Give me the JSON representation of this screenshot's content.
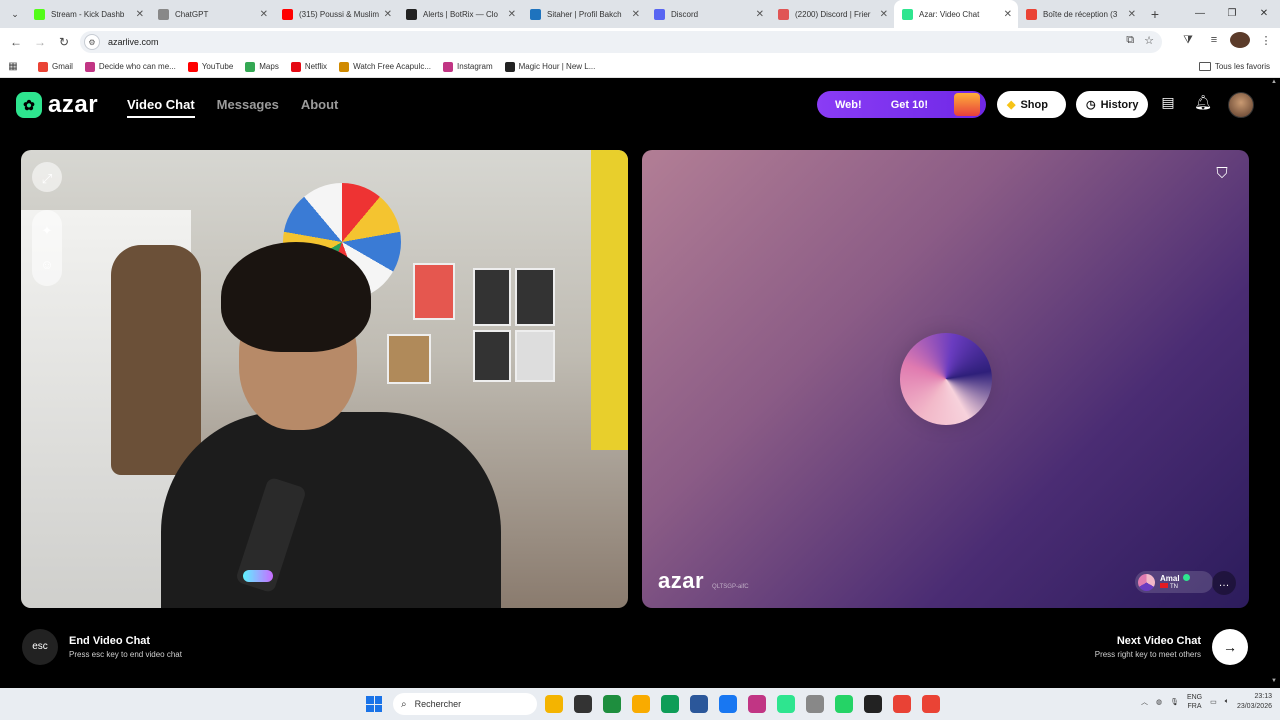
{
  "browser": {
    "tabs": [
      {
        "title": "Stream - Kick Dashb",
        "color": "#53fc18"
      },
      {
        "title": "ChatGPT",
        "color": "#888888"
      },
      {
        "title": "(315) Poussi & Muslim",
        "color": "#ff0000"
      },
      {
        "title": "Alerts | BotRix — Clo",
        "color": "#222222"
      },
      {
        "title": "Sitaher | Profil Bakch",
        "color": "#1e73be"
      },
      {
        "title": "Discord",
        "color": "#5865f2"
      },
      {
        "title": "(2200) Discord | Frier",
        "color": "#e05555"
      },
      {
        "title": "Azar: Video Chat",
        "color": "#2ee58f",
        "active": true
      },
      {
        "title": "Boîte de réception (3",
        "color": "#ea4335"
      }
    ],
    "url": "azarlive.com",
    "bookmarks": [
      {
        "label": "Gmail",
        "color": "#ea4335"
      },
      {
        "label": "Decide who can me...",
        "color": "#c13584"
      },
      {
        "label": "YouTube",
        "color": "#ff0000"
      },
      {
        "label": "Maps",
        "color": "#34a853"
      },
      {
        "label": "Netflix",
        "color": "#e50914"
      },
      {
        "label": "Watch Free Acapulc...",
        "color": "#d08a00"
      },
      {
        "label": "Instagram",
        "color": "#c13584"
      },
      {
        "label": "Magic Hour | New L...",
        "color": "#222222"
      }
    ],
    "all_bookmarks_label": "Tous les favoris"
  },
  "app": {
    "logo_text": "azar",
    "nav": [
      {
        "label": "Video Chat",
        "active": true
      },
      {
        "label": "Messages",
        "active": false
      },
      {
        "label": "About",
        "active": false
      }
    ],
    "promo": {
      "web_label": "Web!",
      "get_label": "Get 10!"
    },
    "shop_label": "Shop",
    "history_label": "History",
    "watermark_logo": "azar",
    "watermark_code": "QLTSGP-aifC",
    "partner": {
      "name": "Amal",
      "country": "TN"
    },
    "end_key": "esc",
    "end_title": "End Video Chat",
    "end_sub": "Press esc key to end video chat",
    "next_title": "Next Video Chat",
    "next_sub": "Press right key to meet others",
    "accent": "#2ee58f"
  },
  "taskbar": {
    "search_placeholder": "Rechercher",
    "lang_top": "ENG",
    "lang_bottom": "FRA",
    "time": "23:13",
    "date": "23/03/2026",
    "apps": [
      "#f4b400",
      "#333333",
      "#1e8e3e",
      "#f9ab00",
      "#0f9d58",
      "#2b579a",
      "#1877f2",
      "#c13584",
      "#2ee58f",
      "#888888",
      "#25d366",
      "#222222",
      "#e94235",
      "#ea4335"
    ]
  }
}
